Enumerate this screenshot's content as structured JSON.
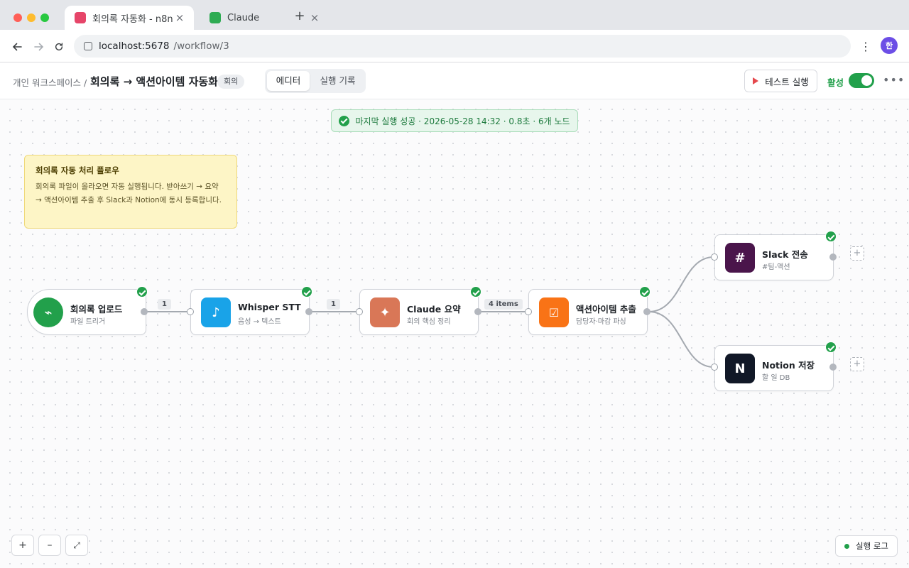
{
  "browser": {
    "tabs": [
      {
        "title": "회의록 자동화 - n8n",
        "close": "×",
        "favicon_color": "#e64569"
      },
      {
        "title": "Claude",
        "close": "×",
        "favicon_color": "#2dab52"
      }
    ],
    "new_tab": "+",
    "url_host": "localhost:5678",
    "url_path": "/workflow/3",
    "profile_initial": "한"
  },
  "header": {
    "breadcrumb": "개인 워크스페이스 /",
    "title": "회의록 → 액션아이템 자동화",
    "tag": "회의",
    "tabs": [
      "에디터",
      "실행 기록"
    ],
    "test_button": "테스트 실행",
    "active_label": "활성",
    "active": true
  },
  "status": {
    "text": "마지막 실행 성공 · 2026-05-28 14:32 · 0.8초 · 6개 노드"
  },
  "sticky_note": {
    "title": "회의록 자동 처리 플로우",
    "body": "회의록 파일이 올라오면 자동 실행됩니다. 받아쓰기 → 요약 → 액션아이템 추출 후 Slack과 Notion에 동시 등록합니다."
  },
  "nodes": [
    {
      "name": "회의록 업로드",
      "subtitle": "파일 트리거",
      "icon": "⌁",
      "icon_name": "lightning-icon",
      "color": "#22a04b",
      "status": "success"
    },
    {
      "name": "Whisper STT",
      "subtitle": "음성 → 텍스트",
      "icon": "♪",
      "icon_name": "music-note-icon",
      "color": "#19a3e8",
      "status": "success"
    },
    {
      "name": "Claude 요약",
      "subtitle": "회의 핵심 정리",
      "icon": "✦",
      "icon_name": "sparkle-icon",
      "color": "#d97757",
      "status": "success"
    },
    {
      "name": "액션아이템 추출",
      "subtitle": "담당자·마감 파싱",
      "icon": "☑",
      "icon_name": "checkbox-icon",
      "color": "#f97316",
      "status": "success"
    },
    {
      "name": "Slack 전송",
      "subtitle": "#팀-액션",
      "icon": "#",
      "icon_name": "hash-icon",
      "color": "#4a154b",
      "status": "success"
    },
    {
      "name": "Notion 저장",
      "subtitle": "할 일 DB",
      "icon": "N",
      "icon_name": "notion-icon",
      "color": "#111827",
      "status": "success"
    }
  ],
  "connections": [
    "1",
    "1",
    "4 items"
  ],
  "add_node": "+",
  "zoom": {
    "in": "+",
    "out": "–",
    "fit": "⤢"
  },
  "exec_log": "실행 로그"
}
